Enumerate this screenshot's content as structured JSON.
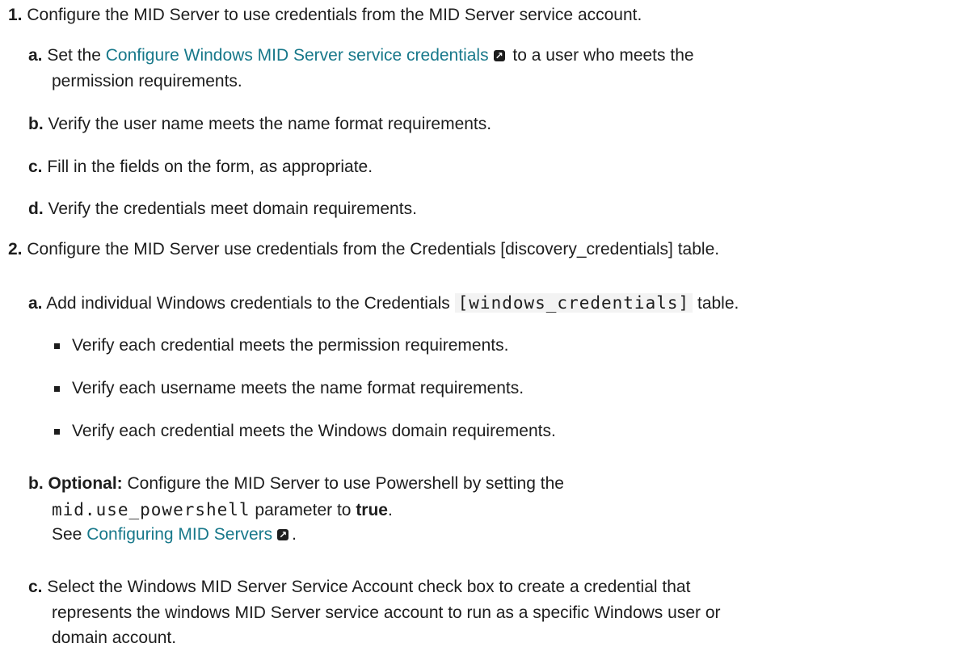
{
  "steps": [
    {
      "num": "1.",
      "text": "Configure the MID Server to use credentials from the MID Server service account.",
      "substeps": [
        {
          "label": "a.",
          "pre": "Set the ",
          "link": "Configure Windows MID Server service credentials",
          "post": " to a user who meets the",
          "cont": "permission requirements."
        },
        {
          "label": "b.",
          "text": "Verify the user name meets the name format requirements."
        },
        {
          "label": "c.",
          "text": "Fill in the fields on the form, as appropriate."
        },
        {
          "label": "d.",
          "text": "Verify the credentials meet domain requirements."
        }
      ]
    },
    {
      "num": "2.",
      "text": "Configure the MID Server use credentials from the Credentials [discovery_credentials] table.",
      "substeps": [
        {
          "label": "a.",
          "pre": "Add individual Windows credentials to the Credentials ",
          "code": "[windows_credentials]",
          "post": " table.",
          "bullets": [
            "Verify each credential meets the permission requirements.",
            "Verify each username meets the name format requirements.",
            "Verify each credential meets the Windows domain requirements."
          ]
        },
        {
          "label": "b.",
          "optional": "Optional:",
          "pre": " Configure the MID Server to use Powershell by setting the",
          "code": "mid.use_powershell",
          "mid": " parameter to ",
          "bold": "true",
          "end": ".",
          "see": "See ",
          "link": "Configuring MID Servers",
          "see_end": "."
        },
        {
          "label": "c.",
          "text": "Select the Windows MID Server Service Account check box to create a credential that",
          "cont": "represents the windows MID Server service account to run as a specific Windows user or",
          "cont2": "domain account."
        }
      ]
    }
  ],
  "icons": {
    "external_link": "external-link-icon"
  }
}
